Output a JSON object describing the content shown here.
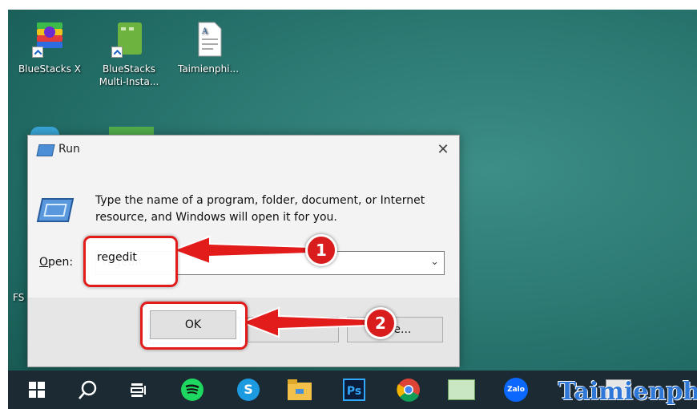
{
  "desktop": {
    "icons": [
      {
        "label": "BlueStacks X",
        "icon": "bluestacks-x-icon"
      },
      {
        "label": "BlueStacks Multi-Insta...",
        "icon": "bluestacks-multi-instance-icon"
      },
      {
        "label": "Taimienphi...",
        "icon": "document-icon"
      }
    ],
    "partial_labels": [
      "FS"
    ]
  },
  "run_dialog": {
    "title": "Run",
    "close_glyph": "✕",
    "description": "Type the name of a program, folder, document, or Internet resource, and Windows will open it for you.",
    "open_label_accel": "O",
    "open_label_rest": "pen:",
    "open_value": "regedit",
    "ok_label": "OK",
    "cancel_label": "",
    "browse_label_visible": "wse..."
  },
  "annotations": {
    "step1": "1",
    "step2": "2",
    "highlight_color": "#e21b1b"
  },
  "taskbar": {
    "items": [
      "windows-start-icon",
      "search-icon",
      "task-view-icon",
      "spotify-icon",
      "skype-icon",
      "file-explorer-icon",
      "photoshop-icon",
      "chrome-icon",
      "app-icon",
      "zalo-icon",
      "terminal-icon"
    ],
    "ps_text": "Ps",
    "zalo_text": "Zalo",
    "skype_text": "S"
  },
  "watermark": {
    "text": "Taimienph"
  }
}
